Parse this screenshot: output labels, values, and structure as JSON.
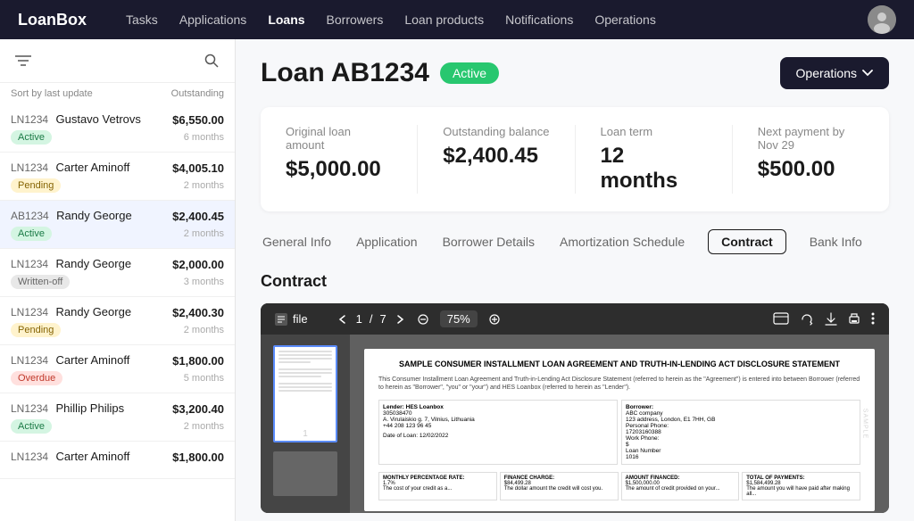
{
  "brand": "LoanBox",
  "navbar": {
    "links": [
      {
        "label": "Tasks",
        "active": false
      },
      {
        "label": "Applications",
        "active": false
      },
      {
        "label": "Loans",
        "active": true
      },
      {
        "label": "Borrowers",
        "active": false
      },
      {
        "label": "Loan products",
        "active": false
      },
      {
        "label": "Notifications",
        "active": false
      },
      {
        "label": "Operations",
        "active": false
      }
    ]
  },
  "sidebar": {
    "sort_label": "Sort by last update",
    "col_label": "Outstanding",
    "loans": [
      {
        "id": "LN1234",
        "name": "Gustavo Vetrovs",
        "amount": "$6,550.00",
        "status": "Active",
        "status_type": "active",
        "time": "6 months",
        "selected": false
      },
      {
        "id": "LN1234",
        "name": "Carter Aminoff",
        "amount": "$4,005.10",
        "status": "Pending",
        "status_type": "pending",
        "time": "2 months",
        "selected": false
      },
      {
        "id": "AB1234",
        "name": "Randy George",
        "amount": "$2,400.45",
        "status": "Active",
        "status_type": "active",
        "time": "2 months",
        "selected": true
      },
      {
        "id": "LN1234",
        "name": "Randy George",
        "amount": "$2,000.00",
        "status": "Written-off",
        "status_type": "written-off",
        "time": "3 months",
        "selected": false
      },
      {
        "id": "LN1234",
        "name": "Randy George",
        "amount": "$2,400.30",
        "status": "Pending",
        "status_type": "pending",
        "time": "2 months",
        "selected": false
      },
      {
        "id": "LN1234",
        "name": "Carter Aminoff",
        "amount": "$1,800.00",
        "status": "Overdue",
        "status_type": "overdue",
        "time": "5 months",
        "selected": false
      },
      {
        "id": "LN1234",
        "name": "Phillip Philips",
        "amount": "$3,200.40",
        "status": "Active",
        "status_type": "active",
        "time": "2 months",
        "selected": false
      },
      {
        "id": "LN1234",
        "name": "Carter Aminoff",
        "amount": "$1,800.00",
        "status": "",
        "status_type": "",
        "time": "",
        "selected": false
      }
    ]
  },
  "loan": {
    "title": "Loan AB1234",
    "status": "Active",
    "operations_label": "Operations",
    "summary": {
      "original_label": "Original loan amount",
      "original_value": "$5,000.00",
      "outstanding_label": "Outstanding balance",
      "outstanding_value": "$2,400.45",
      "term_label": "Loan term",
      "term_value": "12 months",
      "next_payment_label": "Next payment by Nov 29",
      "next_payment_value": "$500.00"
    },
    "tabs": [
      {
        "label": "General Info",
        "active": false
      },
      {
        "label": "Application",
        "active": false
      },
      {
        "label": "Borrower Details",
        "active": false
      },
      {
        "label": "Amortization Schedule",
        "active": false
      },
      {
        "label": "Contract",
        "active": true
      },
      {
        "label": "Bank Info",
        "active": false
      }
    ],
    "contract": {
      "section_title": "Contract",
      "toolbar": {
        "file_label": "file",
        "page_current": "1",
        "page_total": "7",
        "zoom": "75%"
      },
      "doc": {
        "title": "SAMPLE CONSUMER INSTALLMENT LOAN AGREEMENT AND TRUTH-IN-LENDING ACT DISCLOSURE STATEMENT",
        "intro": "This Consumer Installment Loan Agreement and Truth-in-Lending Act Disclosure Statement (referred to herein as the \"Agreement\") is entered into between Borrower (referred to herein as \"Borrower\", \"you\" or \"your\") and HES Loanbox (referred to herein as \"Lender\").",
        "lender_label": "Lender: HES Loanbox",
        "lender_id": "305038470",
        "lender_addr": "A. Virulaiskio g. 7, Vilnius, Lithuania",
        "lender_phone": "+44 208 123 96 45",
        "date_label": "Date of Loan: 12/02/2022",
        "borrower_label": "Borrower:",
        "borrower_name": "ABC company",
        "borrower_addr": "123 address, London, E1 7HH, GB",
        "borrower_phone_label": "Personal Phone:",
        "borrower_phone": "17203160388",
        "work_phone_label": "Work Phone:",
        "work_phone": "$",
        "loan_number_label": "Loan Number",
        "loan_number": "1016",
        "monthly_rate_label": "MONTHLY PERCENTAGE RATE:",
        "monthly_rate": "1.7%",
        "monthly_desc": "The cost of your credit as a...",
        "finance_charge_label": "FINANCE CHARGE:",
        "finance_charge": "$84,499.28",
        "finance_desc": "The dollar amount the credit will cost you.",
        "amount_financed_label": "AMOUNT FINANCED:",
        "amount_financed": "$1,500,000.00",
        "amount_desc": "The amount of credit provided on your...",
        "total_payments_label": "TOTAL OF PAYMENTS:",
        "total_payments": "$1,584,499.28",
        "total_desc": "The amount you will have paid after making all..."
      }
    }
  }
}
